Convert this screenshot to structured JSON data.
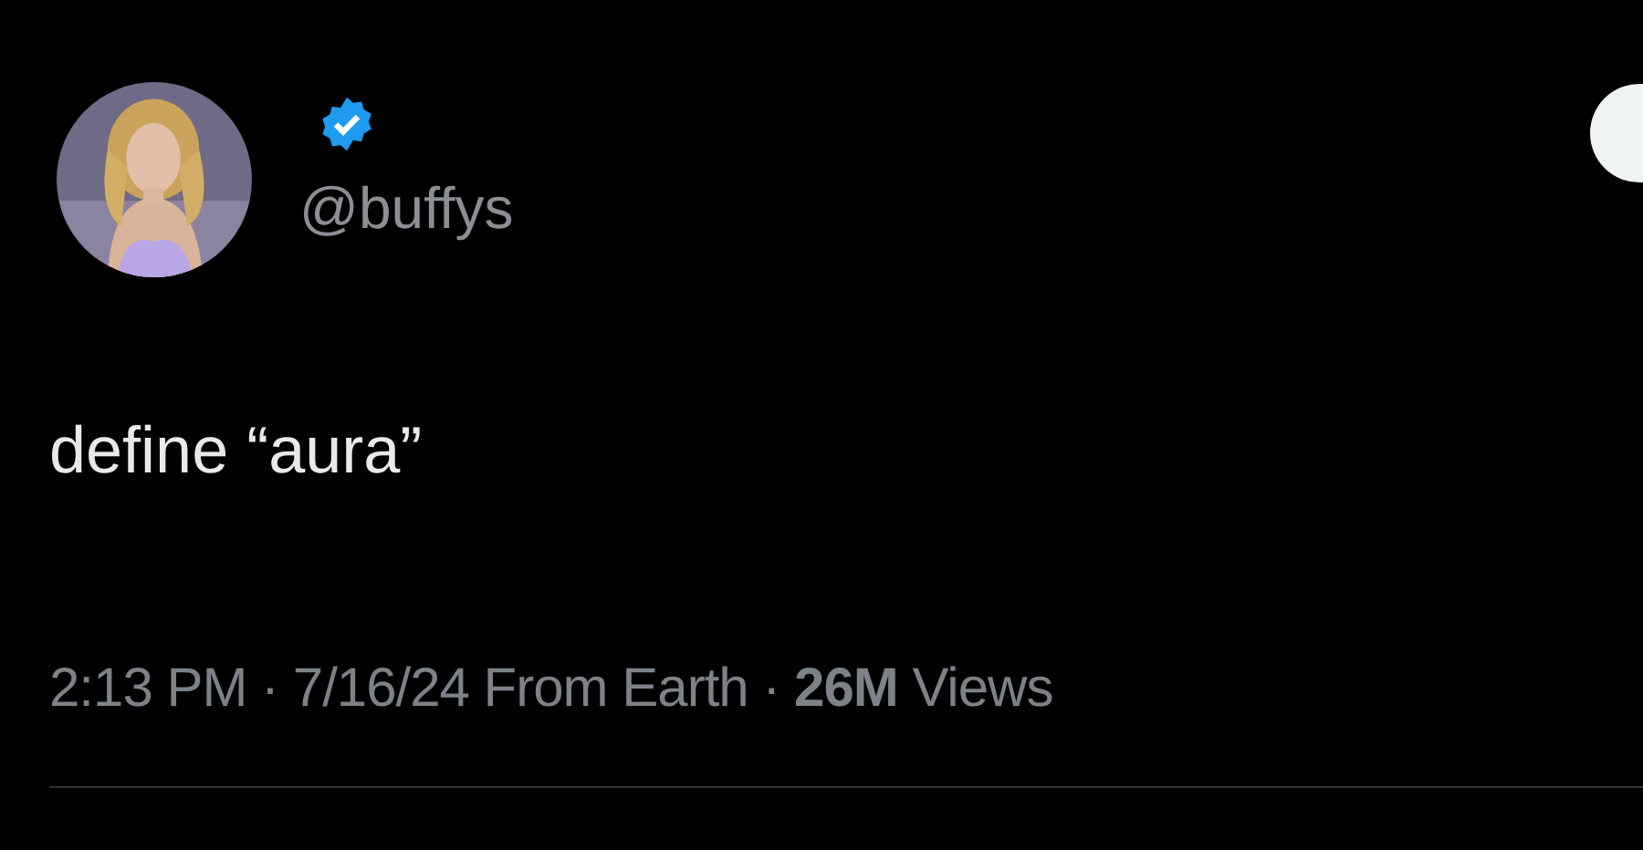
{
  "author": {
    "handle": "@buffys",
    "verified": true
  },
  "tweet": {
    "text": "define “aura”"
  },
  "meta": {
    "line": "2:13 PM · 7/16/24 From Earth · **26M** Views"
  }
}
